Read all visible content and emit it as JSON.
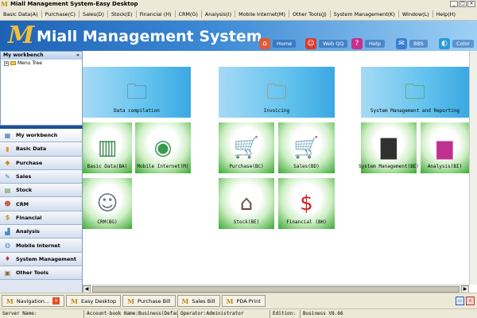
{
  "window": {
    "title": "Miall Management System-Easy Desktop",
    "logo_glyph": "M",
    "minimize": "_",
    "maximize": "□",
    "close": "×"
  },
  "menu": [
    "Basic Data(A)",
    "Purchase(C)",
    "Sales(D)",
    "Stock(E)",
    "Financial (H)",
    "CRM(G)",
    "Analysis(I)",
    "Mobile Internet(M)",
    "Other Tools(J)",
    "System Management(K)",
    "Window(L)",
    "Help(H)"
  ],
  "banner": {
    "logo_glyph": "M",
    "app_name": "Miall Management System",
    "buttons": [
      {
        "label": "Home",
        "icon": "home-icon",
        "glyph": "⌂",
        "color": "#e05a3a"
      },
      {
        "label": "Web QQ",
        "icon": "qq-penguin-icon",
        "glyph": "☺",
        "color": "#d93b2b"
      },
      {
        "label": "Help",
        "icon": "help-icon",
        "glyph": "?",
        "color": "#c8308a"
      },
      {
        "label": "BBS",
        "icon": "bbs-icon",
        "glyph": "✉",
        "color": "#3a7fd0"
      },
      {
        "label": "Color",
        "icon": "palette-icon",
        "glyph": "◐",
        "color": "#2a9bd8"
      }
    ]
  },
  "workbench": {
    "title": "My workbench",
    "collapse": "«",
    "tree": [
      {
        "label": "Menu Tree",
        "expander": "+"
      }
    ]
  },
  "nav": {
    "items": [
      {
        "label": "My workbench",
        "icon": "workbench-icon",
        "glyph": "▦",
        "color": "#3a6fb0"
      },
      {
        "label": "Basic Data",
        "icon": "basic-data-icon",
        "glyph": "▮",
        "color": "#d8a020"
      },
      {
        "label": "Purchase",
        "icon": "purchase-icon",
        "glyph": "◆",
        "color": "#d08a20"
      },
      {
        "label": "Sales",
        "icon": "sales-icon",
        "glyph": "✎",
        "color": "#3a8ad0"
      },
      {
        "label": "Stock",
        "icon": "stock-icon",
        "glyph": "▤",
        "color": "#6a8a40"
      },
      {
        "label": "CRM",
        "icon": "crm-icon",
        "glyph": "☻",
        "color": "#c04a30"
      },
      {
        "label": "Financial",
        "icon": "financial-icon",
        "glyph": "$",
        "color": "#c09020"
      },
      {
        "label": "Analysis",
        "icon": "analysis-icon",
        "glyph": "▟",
        "color": "#4a8ac0"
      },
      {
        "label": "Mobile Internet",
        "icon": "mobile-internet-icon",
        "glyph": "◍",
        "color": "#3a90c0"
      },
      {
        "label": "System Management",
        "icon": "system-management-icon",
        "glyph": "♦",
        "color": "#c03040"
      },
      {
        "label": "Other Tools",
        "icon": "other-tools-icon",
        "glyph": "▣",
        "color": "#8a6a40"
      }
    ]
  },
  "tiles": [
    {
      "label": "Data compilation",
      "icon": "data-compilation-folder-icon",
      "glyph": "🗀",
      "color": "#6a7a88"
    },
    {
      "label": "Invoicing",
      "icon": "invoicing-folder-icon",
      "glyph": "🗀",
      "color": "#b08850"
    },
    {
      "label": "System Management and Reporting",
      "icon": "system-reporting-folder-icon",
      "glyph": "🗀",
      "color": "#5a9a40"
    },
    {
      "label": "Basic Data(BA)",
      "icon": "binders-icon",
      "glyph": "▥",
      "color": "#3a8a50"
    },
    {
      "label": "Mobile Internet(M)",
      "icon": "drive-icon",
      "glyph": "◉",
      "color": "#3a9a50"
    },
    {
      "label": "Purchase(BC)",
      "icon": "cart-download-icon",
      "glyph": "🛒",
      "color": "#b02020"
    },
    {
      "label": "Sales(BD)",
      "icon": "cart-add-icon",
      "glyph": "🛒",
      "color": "#b02020"
    },
    {
      "label": "System Management(BE)",
      "icon": "server-icon",
      "glyph": "▇",
      "color": "#303030"
    },
    {
      "label": "Analysis(BI)",
      "icon": "bar-chart-icon",
      "glyph": "▆",
      "color": "#c03090"
    },
    {
      "label": "CRM(BG)",
      "icon": "contacts-icon",
      "glyph": "☺",
      "color": "#6a7a80"
    },
    {
      "label": "Stock(BE)",
      "icon": "warehouse-icon",
      "glyph": "⌂",
      "color": "#6a5040"
    },
    {
      "label": "Financial (BH)",
      "icon": "money-safe-icon",
      "glyph": "$",
      "color": "#d02020"
    }
  ],
  "scroll": {
    "left": "◀",
    "right": "▶"
  },
  "tasks": [
    {
      "label": "Navigation...",
      "glyph": "M",
      "closable": "×"
    },
    {
      "label": "Easy Desktop",
      "glyph": "M"
    },
    {
      "label": "Purchase Bill",
      "glyph": "M"
    },
    {
      "label": "Sales Bill",
      "glyph": "M"
    },
    {
      "label": "PDA Print",
      "glyph": "M"
    }
  ],
  "task_buttons": {
    "restore": "▭",
    "close": "×"
  },
  "status": [
    "Server Name:",
    "Account-book Name:Business(Defau)",
    "Operator:Administrator",
    "Edition:",
    "Business V8.66"
  ]
}
